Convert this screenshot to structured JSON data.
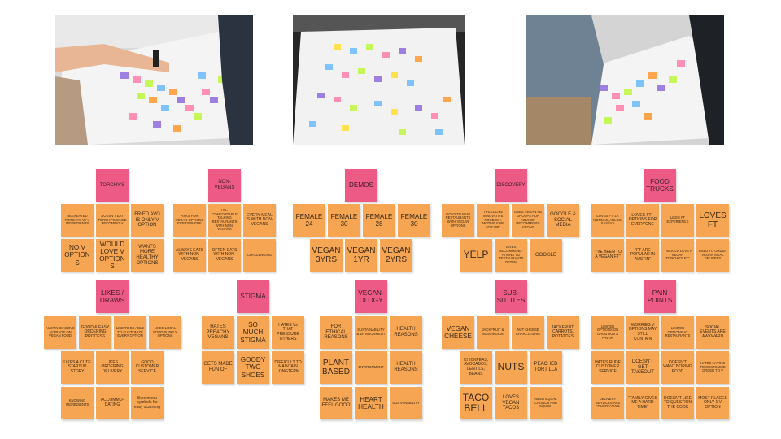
{
  "colors": {
    "note_orange": "#f6a552",
    "note_pink": "#ee5a86",
    "text": "#3a2a17"
  },
  "photos": [
    {
      "name": "workshop-photo-left",
      "desc_icon": "sticky-note-photo"
    },
    {
      "name": "workshop-photo-center",
      "desc_icon": "sticky-note-photo"
    },
    {
      "name": "workshop-photo-right",
      "desc_icon": "sticky-note-photo"
    }
  ],
  "clusters": {
    "torchys": {
      "header": "TORCHY'S",
      "notes": [
        "BEENEATED TORCHYS W/ V INGREDIENTS",
        "DOESN'T EAT TORCHY'S SINCE BECOMING V",
        "FRIED AVO IS ONLY V OPTION",
        "NO V OPTIONS",
        "WOULD LOVE V OPTIONS",
        "WANTS MORE HEALTHY OPTIONS"
      ]
    },
    "non_vegans": {
      "header": "NON-VEGANS",
      "notes": [
        "ASKS FOR VEGAN OPTIONS EVERYWHERE",
        "UN-COMFORTABLE TALKING RESTAURANTS WITH NON-VEGANS",
        "EVERY MEAL IS WITH NON-VEGANS",
        "ALWAYS EATS WITH NON-VEGANS",
        "OFTEN EATS WITH NON-VEGANS",
        "CHALLENGING"
      ]
    },
    "demos": {
      "header": "DEMOS",
      "notes": [
        "FEMALE 24",
        "FEMALE 30",
        "FEMALE 28",
        "FEMALE 30",
        "VEGAN 3YRS",
        "VEGAN 1YR",
        "VEGAN 2YRS"
      ]
    },
    "discovery": {
      "header": "DISCOVERY",
      "notes": [
        "GOES TO NEW RESTAURANTS WITH VEGAN OPTIONS",
        "\"I FEEL LIKE INNOVATIVE FOOD IS A MOTIVE FOR FOR ME\"",
        "USES VEGAN FB GROUPS FOR ADVICE/ RECOMMEND-ATIONS",
        "GOOGLE & SOCIAL MEDIA",
        "YELP",
        "GIVES RECOMMEND-ATIONS TO RESTAURANTS OFTEN",
        "GOOGLE"
      ]
    },
    "food_trucks": {
      "header": "FOOD TRUCKS",
      "notes": [
        "LOVES FT: LA NONNAS, ARLOS, SASSYS",
        "LOVES FT - OPTIONS FOR EVERYONE",
        "LIKES FT EXPERIENCE",
        "LOVES FT",
        "\"I'VE BEEN TO A VEGAN FT\"",
        "\"FT ARE POPULAR IN AUSTIN\"",
        "\"I WOULD LOVE A VEGAN TORCHY'S FT\"",
        "USED TO ORDER VEGAN MEAL DELIVERY"
      ]
    },
    "likes_draws": {
      "header": "LIKES / DRAWS",
      "notes": [
        "AUSTIN IS ABOVE AVERAGE ON VEGAN FOOD",
        "GOOD & EASY ORDERING PROCESS",
        "LIKE TO BE ABLE TO CUSTOMIZE EVERY OPTION",
        "LIKES LOCAL FOOD SUPPLY OPTIONS",
        "LIKES A CUTE STARTUP STORY",
        "LIKES ORDERING DELIVERY",
        "GOOD CUSTOMER SERVICE",
        "KNOWING INGREDIENTS",
        "ACCOMMO-DATING",
        "likes menu symbols for easy scanning"
      ]
    },
    "stigma": {
      "header": "STIGMA",
      "notes": [
        "HATES PREACHY VEGANS",
        "SO MUCH STIGMA",
        "HATES Vs THAT PRESSURE OTHERS",
        "GETS MADE FUN OF",
        "GOODY TWO SHOES",
        "DIFFICULT TO MAINTAIN LONGTERM"
      ]
    },
    "veganology": {
      "header": "VEGAN-OLOGY",
      "notes": [
        "FOR ETHICAL REASONS",
        "SUSTAINABILITY & ENVIRONMENT",
        "HEALTH REASONS",
        "PLANT BASED",
        "ENVIRONMENT",
        "HEALTH REASONS",
        "MAKES ME FEEL GOOD",
        "HEART HEALTH",
        "SUSTAINABILITY"
      ]
    },
    "subsitutes": {
      "header": "SUB-SITUTES",
      "notes": [
        "VEGAN CHEESE",
        "JACKFRUIT & MUSHROOM",
        "NUT CHEESE CHARCUTERIE",
        "JACKFRUIT, CARROTS, POTATOES",
        "CHICKPEAS, AVOCADOS, LENTILS, BEANS",
        "NUTS",
        "PEACHED TORTILLA",
        "TACO BELL",
        "LOVES VEGAN TACOS",
        "NEED EQUAL CRUNCH AND SQUISH"
      ]
    },
    "pain_points": {
      "header": "PAIN POINTS",
      "notes": [
        "LIMITED OPTIONS ON GRUB HUB & FAVOR",
        "WORRIES V OPTIONS MAY STILL CONTAIN",
        "LIMITED OPTIONS AT RESTAURANTS",
        "SOCIAL EVENTS ARE AWKWARD",
        "HATES RUDE CUSTOMER SERVICE",
        "DOESN'T GET TAKEOUT",
        "DOESN'T WANT BORING FOOD",
        "HATES HAVING TO CUSTOMIZE ORDER TO V",
        "DELIVERY SERVICES ARE FRUSTRATING",
        "\"FAMILY GIVES ME A HARD TIME\"",
        "DOESN'T LIKE TO QUESTION THE COOK",
        "MOST PLACES ONLY 1 V OPTION"
      ]
    }
  }
}
